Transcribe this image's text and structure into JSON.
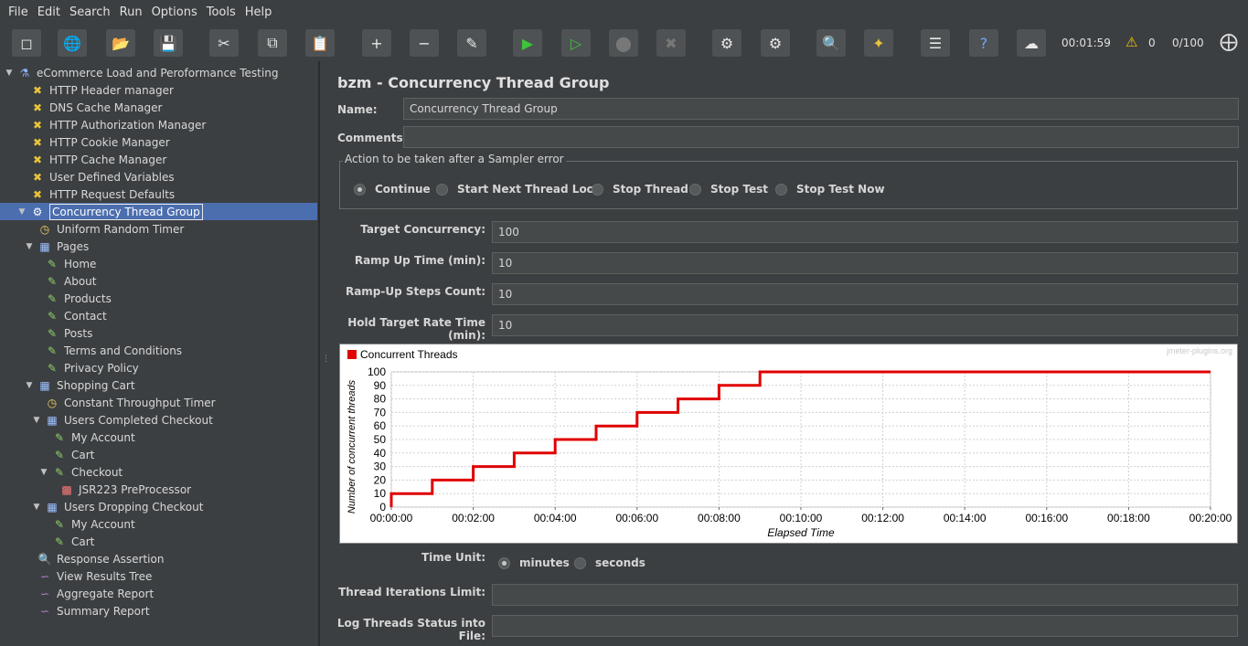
{
  "menu": [
    "File",
    "Edit",
    "Search",
    "Run",
    "Options",
    "Tools",
    "Help"
  ],
  "toolbar": {
    "timer": "00:01:59",
    "warnings": "0",
    "threads": "0/100",
    "icons": [
      "new-icon",
      "templates-icon",
      "open-icon",
      "save-icon",
      "cut-icon",
      "copy-icon",
      "paste-icon",
      "expand-icon",
      "collapse-icon",
      "toggle-icon",
      "start-icon",
      "start-no-pause-icon",
      "stop-icon",
      "shutdown-icon",
      "clear-icon",
      "clear-all-icon",
      "search-icon",
      "reset-search-icon",
      "function-helper-icon",
      "help-icon",
      "remote-icon"
    ]
  },
  "tree": [
    {
      "label": "eCommerce Load and Peroformance Testing",
      "level": 0,
      "toggle": "▼",
      "icon": "test-plan-icon"
    },
    {
      "label": "HTTP Header manager",
      "level": 1,
      "toggle": "",
      "icon": "config-element-icon"
    },
    {
      "label": "DNS Cache Manager",
      "level": 1,
      "toggle": "",
      "icon": "config-element-icon"
    },
    {
      "label": "HTTP Authorization Manager",
      "level": 1,
      "toggle": "",
      "icon": "config-element-icon"
    },
    {
      "label": "HTTP Cookie Manager",
      "level": 1,
      "toggle": "",
      "icon": "config-element-icon"
    },
    {
      "label": "HTTP Cache Manager",
      "level": 1,
      "toggle": "",
      "icon": "config-element-icon"
    },
    {
      "label": "User Defined Variables",
      "level": 1,
      "toggle": "",
      "icon": "config-element-icon"
    },
    {
      "label": "HTTP Request Defaults",
      "level": 1,
      "toggle": "",
      "icon": "config-element-icon"
    },
    {
      "label": "Concurrency Thread Group",
      "level": 1,
      "toggle": "▼",
      "icon": "thread-group-icon",
      "selected": true
    },
    {
      "label": "Uniform Random Timer",
      "level": 2,
      "toggle": "",
      "icon": "timer-icon"
    },
    {
      "label": "Pages",
      "level": 2,
      "toggle": "▼",
      "icon": "controller-icon"
    },
    {
      "label": "Home",
      "level": 3,
      "toggle": "",
      "icon": "sampler-icon"
    },
    {
      "label": "About",
      "level": 3,
      "toggle": "",
      "icon": "sampler-icon"
    },
    {
      "label": "Products",
      "level": 3,
      "toggle": "",
      "icon": "sampler-icon"
    },
    {
      "label": "Contact",
      "level": 3,
      "toggle": "",
      "icon": "sampler-icon"
    },
    {
      "label": "Posts",
      "level": 3,
      "toggle": "",
      "icon": "sampler-icon"
    },
    {
      "label": "Terms and Conditions",
      "level": 3,
      "toggle": "",
      "icon": "sampler-icon"
    },
    {
      "label": "Privacy Policy",
      "level": 3,
      "toggle": "",
      "icon": "sampler-icon"
    },
    {
      "label": "Shopping Cart",
      "level": 2,
      "toggle": "▼",
      "icon": "controller-icon"
    },
    {
      "label": "Constant Throughput Timer",
      "level": 3,
      "toggle": "",
      "icon": "timer-icon"
    },
    {
      "label": "Users Completed Checkout",
      "level": 3,
      "toggle": "▼",
      "icon": "controller-icon"
    },
    {
      "label": "My Account",
      "level": 4,
      "toggle": "",
      "icon": "sampler-icon"
    },
    {
      "label": "Cart",
      "level": 4,
      "toggle": "",
      "icon": "sampler-icon"
    },
    {
      "label": "Checkout",
      "level": 4,
      "toggle": "▼",
      "icon": "sampler-icon"
    },
    {
      "label": "JSR223 PreProcessor",
      "level": 5,
      "toggle": "",
      "icon": "preprocessor-icon"
    },
    {
      "label": "Users Dropping  Checkout",
      "level": 3,
      "toggle": "▼",
      "icon": "controller-icon"
    },
    {
      "label": "My Account",
      "level": 4,
      "toggle": "",
      "icon": "sampler-icon"
    },
    {
      "label": "Cart",
      "level": 4,
      "toggle": "",
      "icon": "sampler-icon"
    },
    {
      "label": "Response Assertion",
      "level": 2,
      "toggle": "",
      "icon": "assertion-icon"
    },
    {
      "label": "View Results Tree",
      "level": 2,
      "toggle": "",
      "icon": "listener-icon"
    },
    {
      "label": "Aggregate Report",
      "level": 2,
      "toggle": "",
      "icon": "listener-icon"
    },
    {
      "label": "Summary Report",
      "level": 2,
      "toggle": "",
      "icon": "listener-icon"
    }
  ],
  "panel": {
    "title": "bzm - Concurrency Thread Group",
    "name_label": "Name:",
    "name_value": "Concurrency Thread Group",
    "comments_label": "Comments:",
    "comments_value": "",
    "error_group_title": "Action to be taken after a Sampler error",
    "error_actions": [
      {
        "label": "Continue",
        "selected": true
      },
      {
        "label": "Start Next Thread Loop",
        "selected": false
      },
      {
        "label": "Stop Thread",
        "selected": false
      },
      {
        "label": "Stop Test",
        "selected": false
      },
      {
        "label": "Stop Test Now",
        "selected": false
      }
    ],
    "target_concurrency_label": "Target Concurrency:",
    "target_concurrency": "100",
    "ramp_up_label": "Ramp Up Time (min):",
    "ramp_up": "10",
    "steps_label": "Ramp-Up Steps Count:",
    "steps": "10",
    "hold_label": "Hold Target Rate Time (min):",
    "hold": "10",
    "time_unit_label": "Time Unit:",
    "time_units": [
      {
        "label": "minutes",
        "selected": true
      },
      {
        "label": "seconds",
        "selected": false
      }
    ],
    "iterations_label": "Thread Iterations Limit:",
    "iterations": "",
    "log_label": "Log Threads Status into File:",
    "log": ""
  },
  "colors": {
    "series": "#e00000",
    "selection": "#4b6eaf"
  },
  "chart_data": {
    "type": "line",
    "title": "",
    "watermark": "jmeter-plugins.org",
    "xlabel": "Elapsed Time",
    "ylabel": "Number of concurrent threads",
    "ylim": [
      0,
      100
    ],
    "xlim_minutes": [
      0,
      20
    ],
    "yticks": [
      "0",
      "10",
      "20",
      "30",
      "40",
      "50",
      "60",
      "70",
      "80",
      "90",
      "100"
    ],
    "xticks": [
      "00:00:00",
      "00:02:00",
      "00:04:00",
      "00:06:00",
      "00:08:00",
      "00:10:00",
      "00:12:00",
      "00:14:00",
      "00:16:00",
      "00:18:00",
      "00:20:00"
    ],
    "grid": true,
    "legend_position": "top-left",
    "series": [
      {
        "name": "Concurrent Threads",
        "step": true,
        "x_minutes": [
          0,
          1,
          2,
          3,
          4,
          5,
          6,
          7,
          8,
          9,
          20
        ],
        "values": [
          10,
          20,
          30,
          40,
          50,
          60,
          70,
          80,
          90,
          100,
          100
        ]
      }
    ]
  }
}
